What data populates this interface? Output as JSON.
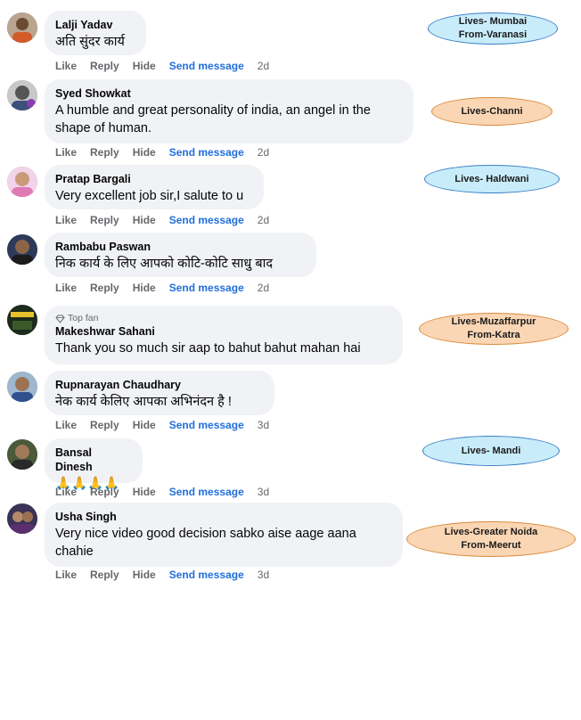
{
  "actions": {
    "like": "Like",
    "reply": "Reply",
    "hide": "Hide",
    "send_message": "Send message"
  },
  "comments": [
    {
      "name": "Lalji Yadav",
      "text": "अति सुंदर कार्य",
      "time": "2d",
      "badge": ""
    },
    {
      "name": "Syed Showkat",
      "text": "A humble and great personality of india, an angel in the shape of human.",
      "time": "2d",
      "badge": ""
    },
    {
      "name": "Pratap Bargali",
      "text": "Very excellent job sir,I salute to u",
      "time": "2d",
      "badge": ""
    },
    {
      "name": "Rambabu Paswan",
      "text": "निक कार्य के लिए आपको कोटि-कोटि साधु बाद",
      "time": "2d",
      "badge": ""
    },
    {
      "name": "Makeshwar Sahani",
      "text": "Thank you so much sir aap to bahut bahut mahan hai",
      "time": "",
      "badge": "Top fan"
    },
    {
      "name": "Rupnarayan Chaudhary",
      "text": "नेक कार्य केलिए आपका अभिनंदन है !",
      "time": "3d",
      "badge": ""
    },
    {
      "name": "Bansal Dinesh",
      "text": "🙏🙏🙏🙏",
      "time": "3d",
      "badge": ""
    },
    {
      "name": "Usha Singh",
      "text": "Very nice video good decision sabko aise aage aana chahie",
      "time": "3d",
      "badge": ""
    }
  ],
  "labels": [
    {
      "text": "Lives- Mumbai\nFrom-Varanasi",
      "color": "blue"
    },
    {
      "text": "Lives-Channi",
      "color": "orange"
    },
    {
      "text": "Lives- Haldwani",
      "color": "blue"
    },
    {
      "text": "Lives-Muzaffarpur\nFrom-Katra",
      "color": "orange"
    },
    {
      "text": "Lives- Mandi",
      "color": "blue"
    },
    {
      "text": "Lives-Greater Noida\nFrom-Meerut",
      "color": "orange"
    }
  ],
  "colors": {
    "bubble": "#f0f2f5",
    "link": "#216fdb",
    "meta": "#65676b",
    "label_blue": "#c9ecfa",
    "label_orange": "#fbd6b4"
  }
}
